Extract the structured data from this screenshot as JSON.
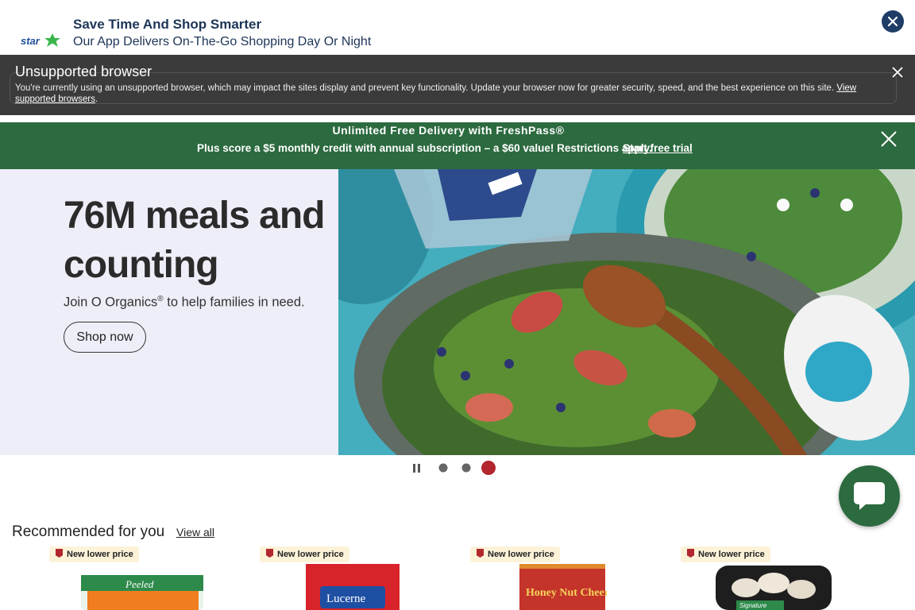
{
  "app_banner": {
    "logo_text": "star",
    "title": "Save Time And Shop Smarter",
    "subtitle": "Our App Delivers On-The-Go Shopping Day Or Night"
  },
  "unsupported": {
    "title": "Unsupported browser",
    "text": "You're currently using an unsupported browser, which may impact the sites display and prevent key functionality. Update your browser now for greater security, speed, and the best experience on this site.",
    "link": "View supported browsers"
  },
  "promo": {
    "title": "Unlimited Free Delivery with FreshPass®",
    "line": "Plus score a $5 monthly credit with annual subscription – a $60 value! Restrictions apply.",
    "link": "Start free trial"
  },
  "hero": {
    "title": "76M meals and counting",
    "subtitle_pre": "Join O Organics",
    "subtitle_reg": "®",
    "subtitle_post": " to help families in need.",
    "button": "Shop now",
    "slides_total": 3,
    "active_slide": 3
  },
  "recommended": {
    "title": "Recommended for you",
    "view_all": "View all",
    "products": [
      {
        "badge": "New lower price",
        "package_text": "Peeled"
      },
      {
        "badge": "New lower price",
        "package_text": "Lucerne"
      },
      {
        "badge": "New lower price",
        "package_text": "Honey Nut Cheerios"
      },
      {
        "badge": "New lower price",
        "package_text": "Signature"
      }
    ]
  },
  "colors": {
    "brand_green": "#2c6a3f",
    "banner_navy": "#1f3d66",
    "dark_bar": "#3b3b3b",
    "active_dot": "#b3262e"
  }
}
